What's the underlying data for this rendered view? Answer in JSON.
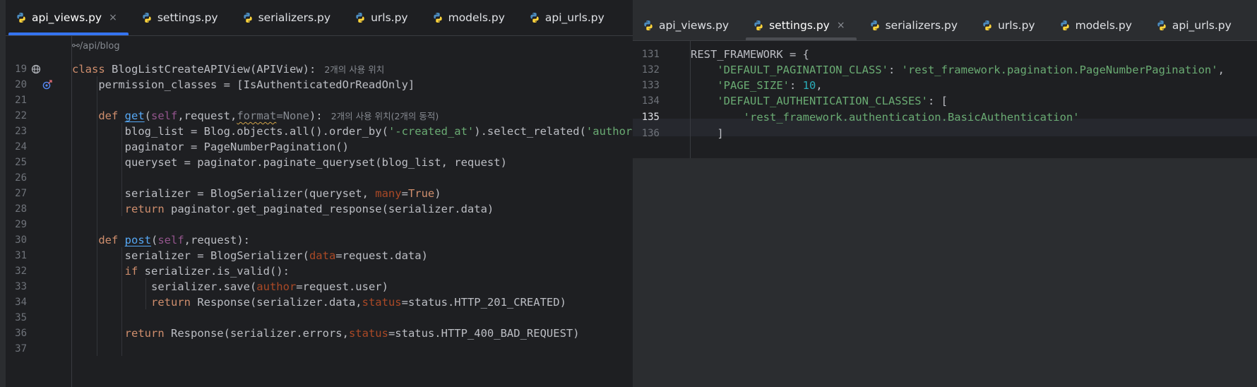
{
  "left": {
    "tabs": [
      {
        "label": "api_views.py",
        "active": true,
        "closable": true
      },
      {
        "label": "settings.py"
      },
      {
        "label": "serializers.py"
      },
      {
        "label": "urls.py"
      },
      {
        "label": "models.py"
      },
      {
        "label": "api_urls.py"
      }
    ],
    "route_hint": "/api/blog",
    "line_numbers": [
      "19",
      "20",
      "21",
      "22",
      "23",
      "24",
      "25",
      "26",
      "27",
      "28",
      "29",
      "30",
      "31",
      "32",
      "33",
      "34",
      "35",
      "36",
      "37"
    ],
    "usage_hint_class": "2개의 사용 위치",
    "usage_hint_get": "2개의 사용 위치(2개의 동적)",
    "code": {
      "l19": {
        "kw": "class",
        "name": "BlogListCreateAPIView(APIView):"
      },
      "l20": {
        "text": "    permission_classes = [IsAuthenticatedOrReadOnly]"
      },
      "l22": {
        "indent": "    ",
        "kw": "def",
        "fn": "get",
        "p1": "(",
        "self": "self",
        "p2": ",request,",
        "p3": "format",
        "p4": "=",
        "kw2": "None",
        "p5": "):"
      },
      "l23": {
        "a": "        blog_list = Blog.objects.all().order_by(",
        "s1": "'-created_at'",
        "b": ").select_related(",
        "s2": "'author'",
        "c": ")"
      },
      "l24": {
        "text": "        paginator = PageNumberPagination()"
      },
      "l25": {
        "text": "        queryset = paginator.paginate_queryset(blog_list, request)"
      },
      "l27": {
        "a": "        serializer = BlogSerializer(queryset, ",
        "p": "many",
        "eq": "=",
        "kw": "True",
        "c": ")"
      },
      "l28": {
        "indent": "        ",
        "kw": "return",
        "rest": " paginator.get_paginated_response(serializer.data)"
      },
      "l30": {
        "indent": "    ",
        "kw": "def",
        "fn": "post",
        "p1": "(",
        "self": "self",
        "p2": ",request):"
      },
      "l31": {
        "a": "        serializer = BlogSerializer(",
        "p": "data",
        "b": "=request.data)"
      },
      "l32": {
        "indent": "        ",
        "kw": "if",
        "rest": " serializer.is_valid():"
      },
      "l33": {
        "a": "            serializer.save(",
        "p": "author",
        "b": "=request.user)"
      },
      "l34": {
        "indent": "            ",
        "kw": "return",
        "a": " Response(serializer.data,",
        "p": "status",
        "b": "=status.HTTP_201_CREATED)"
      },
      "l36": {
        "indent": "        ",
        "kw": "return",
        "a": " Response(serializer.errors,",
        "p": "status",
        "b": "=status.HTTP_400_BAD_REQUEST)"
      }
    }
  },
  "right": {
    "tabs": [
      {
        "label": "api_views.py"
      },
      {
        "label": "settings.py",
        "active": true,
        "closable": true
      },
      {
        "label": "serializers.py"
      },
      {
        "label": "urls.py"
      },
      {
        "label": "models.py"
      },
      {
        "label": "api_urls.py"
      }
    ],
    "line_numbers": [
      "131",
      "132",
      "133",
      "134",
      "135",
      "136"
    ],
    "current_line": "135",
    "code": {
      "l131": {
        "text": "REST_FRAMEWORK = {"
      },
      "l132": {
        "indent": "    ",
        "s": "'DEFAULT_PAGINATION_CLASS'",
        "m": ": ",
        "s2": "'rest_framework.pagination.PageNumberPagination'",
        "e": ","
      },
      "l133": {
        "indent": "    ",
        "s": "'PAGE_SIZE'",
        "m": ": ",
        "n": "10",
        "e": ","
      },
      "l134": {
        "indent": "    ",
        "s": "'DEFAULT_AUTHENTICATION_CLASSES'",
        "m": ": ["
      },
      "l135": {
        "indent": "        ",
        "s": "'rest_framework.authentication.BasicAuthentication'"
      },
      "l136": {
        "text": "    ]"
      }
    }
  },
  "close_glyph": "×",
  "colors": {
    "accent": "#3574f0",
    "keyword": "#cf8e6d",
    "string": "#6aab73",
    "number": "#2aacb8",
    "param": "#aa4926",
    "self": "#94558d",
    "function": "#56a8f5"
  }
}
